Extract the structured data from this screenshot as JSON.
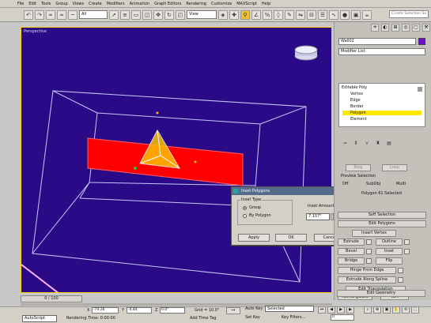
{
  "menu": [
    "File",
    "Edit",
    "Tools",
    "Group",
    "Views",
    "Create",
    "Modifiers",
    "Animation",
    "Graph Editors",
    "Rendering",
    "Customize",
    "MAXScript",
    "Help"
  ],
  "toolbar": {
    "selection_filter": "All",
    "reference_coord": "View",
    "search_placeholder": "Create Selection Se"
  },
  "viewport": {
    "label": "Perspective",
    "background": "#2a0a86",
    "polygon_color": "#ff0000"
  },
  "dialog": {
    "title": "Inset Polygons",
    "group_label": "Inset Type",
    "radio_group": "Group",
    "radio_by_polygon": "By Polygon",
    "amount_label": "Inset Amount:",
    "amount_value": "7.157\"",
    "apply": "Apply",
    "ok": "OK",
    "cancel": "Cancel",
    "close": "X"
  },
  "panel": {
    "object_name": "Wall02",
    "object_color": "#6a10c8",
    "modifier_list": "Modifier List",
    "stack": {
      "root": "Editable Poly",
      "items": [
        "Vertex",
        "Edge",
        "Border",
        "Polygon",
        "Element"
      ],
      "selected_index": 3
    },
    "selection": {
      "ring": "Ring",
      "loop": "Loop",
      "preview_label": "Preview Selection",
      "off": "Off",
      "subobj": "SubObj",
      "multi": "Multi",
      "status": "Polygon 61 Selected"
    },
    "soft_selection": "Soft Selection",
    "edit_polygons": "Edit Polygons",
    "insert_vertex": "Insert Vertex",
    "extrude": "Extrude",
    "outline": "Outline",
    "bevel": "Bevel",
    "inset": "Inset",
    "bridge": "Bridge",
    "flip": "Flip",
    "hinge_from_edge": "Hinge From Edge",
    "extrude_along_spline": "Extrude Along Spline",
    "edit_triangulation": "Edit Triangulation",
    "retriangulate": "Retriangulate",
    "turn": "Turn",
    "edit_geometry": "Edit Geometry"
  },
  "bottom": {
    "time_slider": "0 / 100",
    "listener": "AutoScript",
    "x_value": "-74.26",
    "y_value": "-4.44",
    "z_value": "0.0\"",
    "grid": "Grid = 10.0\"",
    "auto_key": "Auto Key",
    "key_mode": "Selected",
    "set_key": "Set Key",
    "key_filters": "Key Filters...",
    "frame_value": "0",
    "status_text": "Rendering Time: 0:00:00",
    "add_time_tag": "Add Time Tag"
  }
}
